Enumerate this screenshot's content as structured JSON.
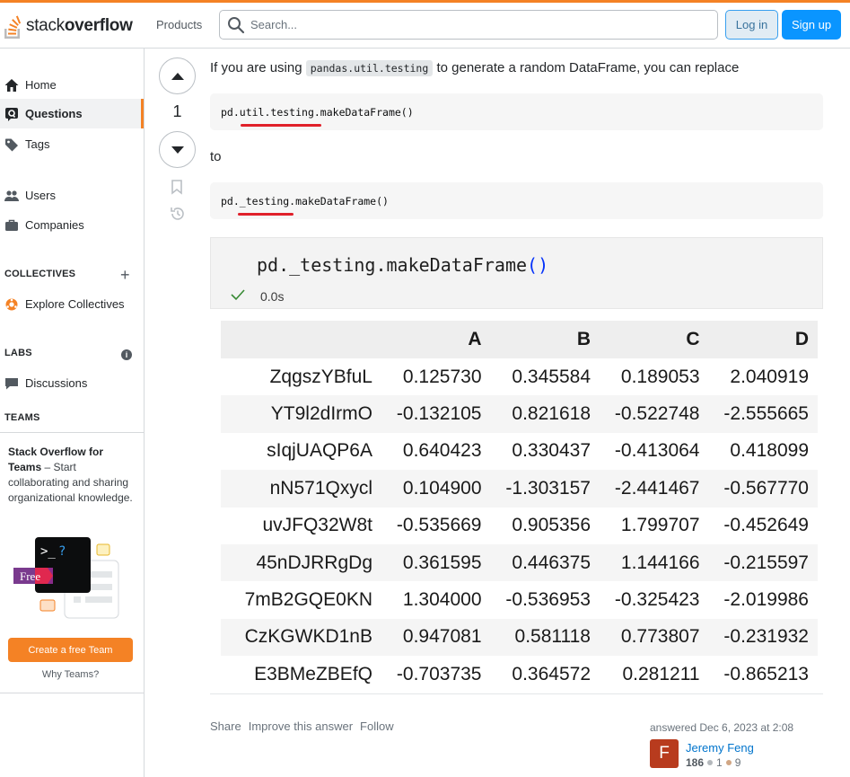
{
  "brand": {
    "logo_prefix": "stack",
    "logo_bold": "overflow",
    "accent": "#f48225",
    "link": "#0074cc",
    "primary_button": "#0a95ff"
  },
  "header": {
    "products_label": "Products",
    "search_placeholder": "Search...",
    "login_label": "Log in",
    "signup_label": "Sign up"
  },
  "sidebar": {
    "items": [
      {
        "label": "Home",
        "icon": "home-icon"
      },
      {
        "label": "Questions",
        "icon": "questions-icon"
      },
      {
        "label": "Tags",
        "icon": "tag-icon"
      },
      {
        "label": "Users",
        "icon": "users-icon"
      },
      {
        "label": "Companies",
        "icon": "briefcase-icon"
      }
    ],
    "collectives_title": "COLLECTIVES",
    "explore_collectives": "Explore Collectives",
    "labs_title": "LABS",
    "discussions": "Discussions",
    "teams_title": "TEAMS",
    "teams_heading": "Stack Overflow for Teams",
    "teams_sep": " – ",
    "teams_body": "Start collaborating and sharing organizational knowledge.",
    "free_badge": "Free",
    "create_team_button": "Create a free Team",
    "why_teams": "Why Teams?"
  },
  "vote": {
    "count": "1"
  },
  "answer": {
    "intro_before": "If you are using ",
    "intro_code": "pandas.util.testing",
    "intro_after": " to generate a random DataFrame, you can replace",
    "code1_prefix": "pd.",
    "code1_mid": "util.testing",
    "code1_suffix": ".makeDataFrame()",
    "to_text": "to",
    "code2_prefix": "pd.",
    "code2_mid": "_testing",
    "code2_suffix": ".makeDataFrame()",
    "notebook": {
      "code_main": "pd._testing.makeDataFrame",
      "code_paren": "()",
      "exec_time": "0.0s"
    },
    "dataframe": {
      "columns": [
        "",
        "A",
        "B",
        "C",
        "D"
      ],
      "rows": [
        [
          "ZqgszYBfuL",
          "0.125730",
          "0.345584",
          "0.189053",
          "2.040919"
        ],
        [
          "YT9l2dIrmO",
          "-0.132105",
          "0.821618",
          "-0.522748",
          "-2.555665"
        ],
        [
          "sIqjUAQP6A",
          "0.640423",
          "0.330437",
          "-0.413064",
          "0.418099"
        ],
        [
          "nN571Qxycl",
          "0.104900",
          "-1.303157",
          "-2.441467",
          "-0.567770"
        ],
        [
          "uvJFQ32W8t",
          "-0.535669",
          "0.905356",
          "1.799707",
          "-0.452649"
        ],
        [
          "45nDJRRgDg",
          "0.361595",
          "0.446375",
          "1.144166",
          "-0.215597"
        ],
        [
          "7mB2GQE0KN",
          "1.304000",
          "-0.536953",
          "-0.325423",
          "-2.019986"
        ],
        [
          "CzKGWKD1nB",
          "0.947081",
          "0.581118",
          "0.773807",
          "-0.231932"
        ],
        [
          "E3BMeZBEfQ",
          "-0.703735",
          "0.364572",
          "0.281211",
          "-0.865213"
        ]
      ]
    },
    "actions": [
      "Share",
      "Improve this answer",
      "Follow"
    ],
    "answered_label": "answered Dec 6, 2023 at 2:08",
    "user": {
      "avatar_letter": "F",
      "name": "Jeremy Feng",
      "reputation": "186",
      "silver": "1",
      "bronze": "9"
    }
  }
}
